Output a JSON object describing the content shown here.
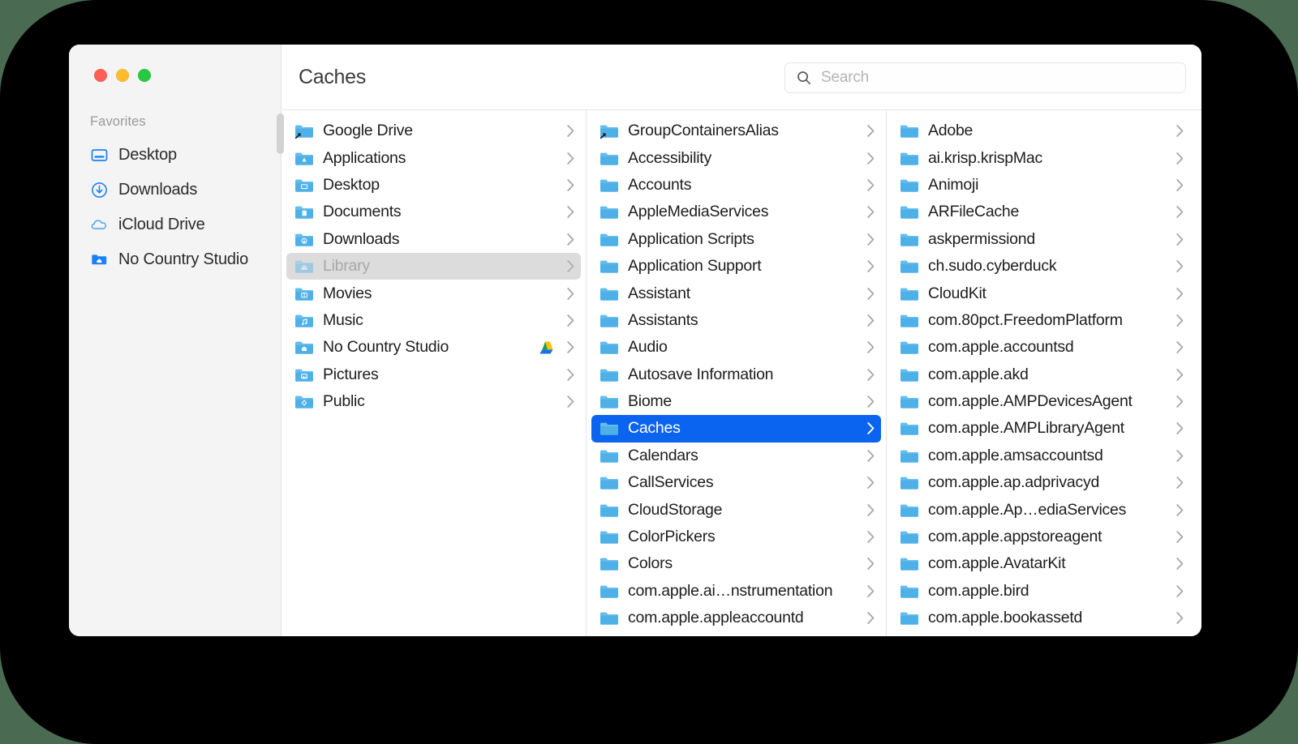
{
  "window": {
    "title": "Caches",
    "traffic_lights": [
      {
        "name": "close",
        "color": "#ff5f57"
      },
      {
        "name": "minimize",
        "color": "#febc2e"
      },
      {
        "name": "maximize",
        "color": "#28c840"
      }
    ]
  },
  "search": {
    "placeholder": "Search",
    "value": "",
    "icon": "search-icon"
  },
  "sidebar": {
    "section_label": "Favorites",
    "items": [
      {
        "label": "Desktop",
        "icon": "desktop-icon"
      },
      {
        "label": "Downloads",
        "icon": "downloads-arrow-icon"
      },
      {
        "label": "iCloud Drive",
        "icon": "icloud-cloud-icon"
      },
      {
        "label": "No Country Studio",
        "icon": "folder-home-icon"
      }
    ]
  },
  "columns": [
    {
      "name": "column-home",
      "items": [
        {
          "label": "Google Drive",
          "icon": "folder-alias-icon",
          "state": "normal",
          "badge": ""
        },
        {
          "label": "Applications",
          "icon": "folder-applications-icon",
          "state": "normal",
          "badge": ""
        },
        {
          "label": "Desktop",
          "icon": "folder-desktop-icon",
          "state": "normal",
          "badge": ""
        },
        {
          "label": "Documents",
          "icon": "folder-documents-icon",
          "state": "normal",
          "badge": ""
        },
        {
          "label": "Downloads",
          "icon": "folder-downloads-icon",
          "state": "normal",
          "badge": ""
        },
        {
          "label": "Library",
          "icon": "folder-library-icon",
          "state": "dimmed",
          "badge": ""
        },
        {
          "label": "Movies",
          "icon": "folder-movies-icon",
          "state": "normal",
          "badge": ""
        },
        {
          "label": "Music",
          "icon": "folder-music-icon",
          "state": "normal",
          "badge": ""
        },
        {
          "label": "No Country Studio",
          "icon": "folder-home-icon",
          "state": "normal",
          "badge": "google-drive-badge"
        },
        {
          "label": "Pictures",
          "icon": "folder-pictures-icon",
          "state": "normal",
          "badge": ""
        },
        {
          "label": "Public",
          "icon": "folder-public-icon",
          "state": "normal",
          "badge": ""
        }
      ]
    },
    {
      "name": "column-library",
      "items": [
        {
          "label": "GroupContainersAlias",
          "icon": "folder-alias-icon",
          "state": "normal",
          "badge": ""
        },
        {
          "label": "Accessibility",
          "icon": "folder-icon",
          "state": "normal",
          "badge": ""
        },
        {
          "label": "Accounts",
          "icon": "folder-icon",
          "state": "normal",
          "badge": ""
        },
        {
          "label": "AppleMediaServices",
          "icon": "folder-icon",
          "state": "normal",
          "badge": ""
        },
        {
          "label": "Application Scripts",
          "icon": "folder-icon",
          "state": "normal",
          "badge": ""
        },
        {
          "label": "Application Support",
          "icon": "folder-icon",
          "state": "normal",
          "badge": ""
        },
        {
          "label": "Assistant",
          "icon": "folder-icon",
          "state": "normal",
          "badge": ""
        },
        {
          "label": "Assistants",
          "icon": "folder-icon",
          "state": "normal",
          "badge": ""
        },
        {
          "label": "Audio",
          "icon": "folder-icon",
          "state": "normal",
          "badge": ""
        },
        {
          "label": "Autosave Information",
          "icon": "folder-icon",
          "state": "normal",
          "badge": ""
        },
        {
          "label": "Biome",
          "icon": "folder-icon",
          "state": "normal",
          "badge": ""
        },
        {
          "label": "Caches",
          "icon": "folder-icon",
          "state": "selected",
          "badge": ""
        },
        {
          "label": "Calendars",
          "icon": "folder-icon",
          "state": "normal",
          "badge": ""
        },
        {
          "label": "CallServices",
          "icon": "folder-icon",
          "state": "normal",
          "badge": ""
        },
        {
          "label": "CloudStorage",
          "icon": "folder-icon",
          "state": "normal",
          "badge": ""
        },
        {
          "label": "ColorPickers",
          "icon": "folder-icon",
          "state": "normal",
          "badge": ""
        },
        {
          "label": "Colors",
          "icon": "folder-icon",
          "state": "normal",
          "badge": ""
        },
        {
          "label": "com.apple.ai…nstrumentation",
          "icon": "folder-icon",
          "state": "normal",
          "badge": ""
        },
        {
          "label": "com.apple.appleaccountd",
          "icon": "folder-icon",
          "state": "normal",
          "badge": ""
        }
      ]
    },
    {
      "name": "column-caches",
      "items": [
        {
          "label": "Adobe",
          "icon": "folder-icon",
          "state": "normal",
          "badge": ""
        },
        {
          "label": "ai.krisp.krispMac",
          "icon": "folder-icon",
          "state": "normal",
          "badge": ""
        },
        {
          "label": "Animoji",
          "icon": "folder-icon",
          "state": "normal",
          "badge": ""
        },
        {
          "label": "ARFileCache",
          "icon": "folder-icon",
          "state": "normal",
          "badge": ""
        },
        {
          "label": "askpermissiond",
          "icon": "folder-icon",
          "state": "normal",
          "badge": ""
        },
        {
          "label": "ch.sudo.cyberduck",
          "icon": "folder-icon",
          "state": "normal",
          "badge": ""
        },
        {
          "label": "CloudKit",
          "icon": "folder-icon",
          "state": "normal",
          "badge": ""
        },
        {
          "label": "com.80pct.FreedomPlatform",
          "icon": "folder-icon",
          "state": "normal",
          "badge": ""
        },
        {
          "label": "com.apple.accountsd",
          "icon": "folder-icon",
          "state": "normal",
          "badge": ""
        },
        {
          "label": "com.apple.akd",
          "icon": "folder-icon",
          "state": "normal",
          "badge": ""
        },
        {
          "label": "com.apple.AMPDevicesAgent",
          "icon": "folder-icon",
          "state": "normal",
          "badge": ""
        },
        {
          "label": "com.apple.AMPLibraryAgent",
          "icon": "folder-icon",
          "state": "normal",
          "badge": ""
        },
        {
          "label": "com.apple.amsaccountsd",
          "icon": "folder-icon",
          "state": "normal",
          "badge": ""
        },
        {
          "label": "com.apple.ap.adprivacyd",
          "icon": "folder-icon",
          "state": "normal",
          "badge": ""
        },
        {
          "label": "com.apple.Ap…ediaServices",
          "icon": "folder-icon",
          "state": "normal",
          "badge": ""
        },
        {
          "label": "com.apple.appstoreagent",
          "icon": "folder-icon",
          "state": "normal",
          "badge": ""
        },
        {
          "label": "com.apple.AvatarKit",
          "icon": "folder-icon",
          "state": "normal",
          "badge": ""
        },
        {
          "label": "com.apple.bird",
          "icon": "folder-icon",
          "state": "normal",
          "badge": ""
        },
        {
          "label": "com.apple.bookassetd",
          "icon": "folder-icon",
          "state": "normal",
          "badge": ""
        }
      ]
    }
  ],
  "colors": {
    "selection_blue": "#0a64f0",
    "folder_blue": "#4aace3",
    "sidebar_bg": "#f4f4f4",
    "accent_sidebar_icon": "#1b82f5",
    "canvas_bg": "#000000",
    "page_bg": "#4a6b51"
  }
}
